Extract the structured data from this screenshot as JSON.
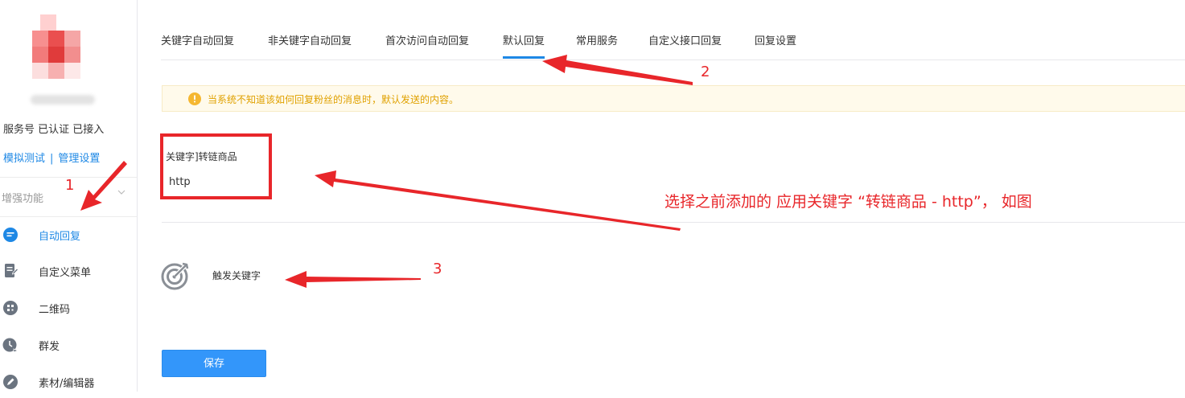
{
  "account": {
    "status": "服务号 已认证 已接入",
    "links": [
      "模拟测试",
      "管理设置"
    ],
    "separator": "|"
  },
  "sidebar": {
    "group_label": "增强功能",
    "items": [
      {
        "label": "自动回复",
        "icon": "chat-bubble-icon",
        "active": true
      },
      {
        "label": "自定义菜单",
        "icon": "document-edit-icon",
        "active": false
      },
      {
        "label": "二维码",
        "icon": "qrcode-icon",
        "active": false
      },
      {
        "label": "群发",
        "icon": "clock-send-icon",
        "active": false
      },
      {
        "label": "素材/编辑器",
        "icon": "pencil-icon",
        "active": false
      }
    ]
  },
  "tabs": [
    {
      "label": "关键字自动回复",
      "active": false
    },
    {
      "label": "非关键字自动回复",
      "active": false
    },
    {
      "label": "首次访问自动回复",
      "active": false
    },
    {
      "label": "默认回复",
      "active": true
    },
    {
      "label": "常用服务",
      "active": false
    },
    {
      "label": "自定义接口回复",
      "active": false
    },
    {
      "label": "回复设置",
      "active": false
    }
  ],
  "tip": {
    "text": "当系统不知道该如何回复粉丝的消息时，默认发送的内容。",
    "icon": "info-icon"
  },
  "keyword": {
    "label": "关键字]转链商品",
    "value": "http"
  },
  "trigger": {
    "label": "触发关键字",
    "icon": "target-arrow-icon"
  },
  "save_label": "保存",
  "annotations": {
    "marker1": "1",
    "marker2": "2",
    "marker3": "3",
    "note": "选择之前添加的 应用关键字 “转链商品 - http”， 如图"
  },
  "colors": {
    "accent": "#1e88e5",
    "button": "#3396fa",
    "annotation": "#e8262a",
    "tip_bg": "#fffaeb",
    "tip_text": "#e0a100"
  }
}
